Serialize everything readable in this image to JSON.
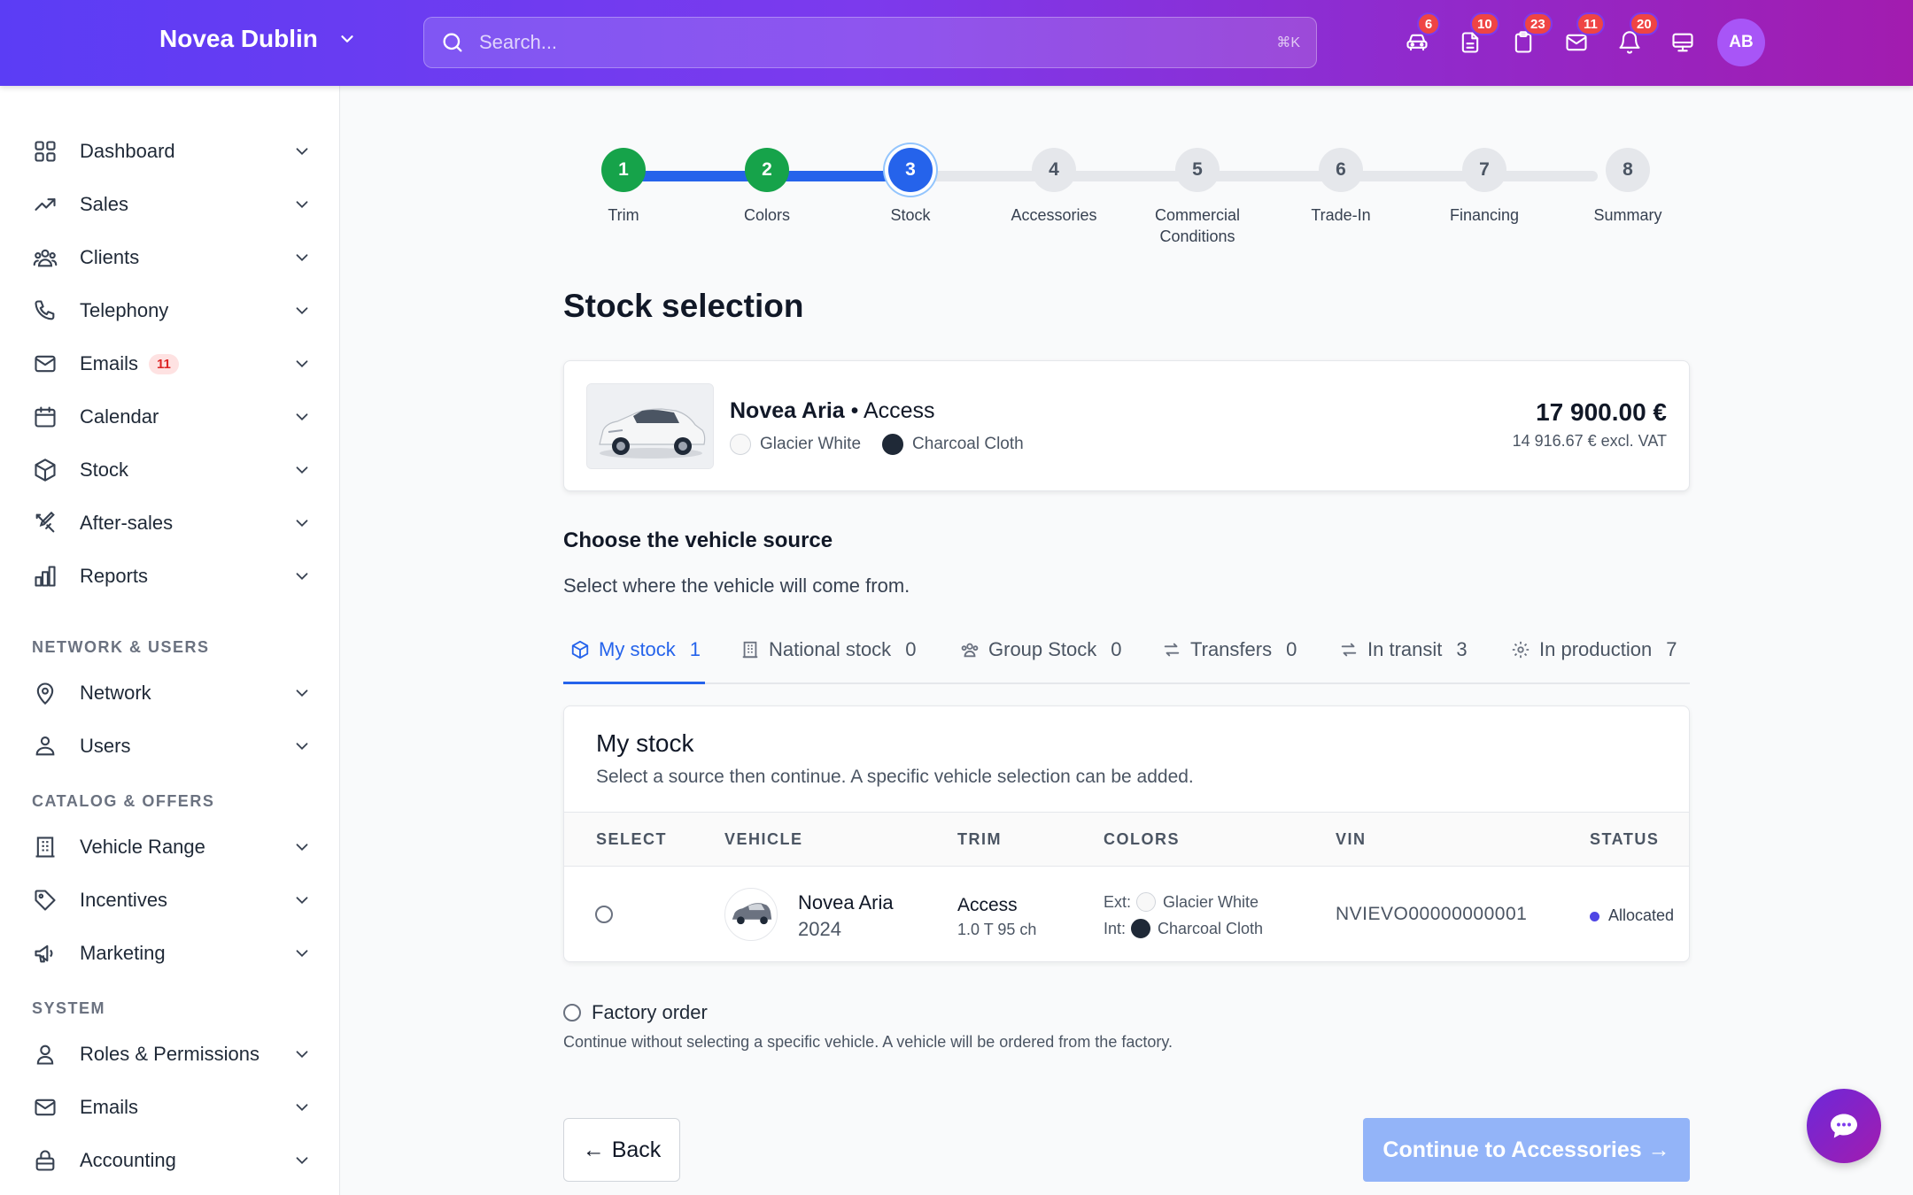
{
  "header": {
    "brand": "Novea Dublin",
    "search_placeholder": "Search...",
    "search_shortcut": "⌘K",
    "icons": [
      {
        "name": "car-icon",
        "badge": "6"
      },
      {
        "name": "document-icon",
        "badge": "10"
      },
      {
        "name": "clipboard-icon",
        "badge": "23"
      },
      {
        "name": "mail-icon",
        "badge": "11"
      },
      {
        "name": "bell-icon",
        "badge": "20"
      },
      {
        "name": "monitor-icon",
        "badge": ""
      }
    ],
    "avatar_initials": "AB"
  },
  "sidebar": {
    "items": [
      {
        "label": "Dashboard",
        "icon": "grid-icon"
      },
      {
        "label": "Sales",
        "icon": "trending-up-icon"
      },
      {
        "label": "Clients",
        "icon": "users-icon"
      },
      {
        "label": "Telephony",
        "icon": "phone-icon"
      },
      {
        "label": "Emails",
        "icon": "mail-icon",
        "badge": "11"
      },
      {
        "label": "Calendar",
        "icon": "calendar-icon"
      },
      {
        "label": "Stock",
        "icon": "box-icon"
      },
      {
        "label": "After-sales",
        "icon": "tools-icon"
      },
      {
        "label": "Reports",
        "icon": "bar-chart-icon"
      }
    ],
    "section_network": "NETWORK & USERS",
    "network_items": [
      {
        "label": "Network",
        "icon": "map-pin-icon"
      },
      {
        "label": "Users",
        "icon": "user-group-icon"
      }
    ],
    "section_catalog": "CATALOG & OFFERS",
    "catalog_items": [
      {
        "label": "Vehicle Range",
        "icon": "building-icon"
      },
      {
        "label": "Incentives",
        "icon": "tag-icon"
      },
      {
        "label": "Marketing",
        "icon": "megaphone-icon"
      }
    ],
    "section_system": "SYSTEM",
    "system_items": [
      {
        "label": "Roles & Permissions",
        "icon": "user-icon"
      },
      {
        "label": "Emails",
        "icon": "mail-icon"
      },
      {
        "label": "Accounting",
        "icon": "lock-icon"
      }
    ]
  },
  "stepper": {
    "current": 3,
    "steps": [
      {
        "num": "1",
        "label": "Trim",
        "state": "done"
      },
      {
        "num": "2",
        "label": "Colors",
        "state": "done"
      },
      {
        "num": "3",
        "label": "Stock",
        "state": "current"
      },
      {
        "num": "4",
        "label": "Accessories",
        "state": "todo"
      },
      {
        "num": "5",
        "label": "Commercial Conditions",
        "state": "todo"
      },
      {
        "num": "6",
        "label": "Trade-In",
        "state": "todo"
      },
      {
        "num": "7",
        "label": "Financing",
        "state": "todo"
      },
      {
        "num": "8",
        "label": "Summary",
        "state": "todo"
      }
    ]
  },
  "page": {
    "title": "Stock selection"
  },
  "vehicle": {
    "model": "Novea Aria",
    "separator": " • ",
    "trim": "Access",
    "exterior": "Glacier White",
    "interior": "Charcoal Cloth",
    "exterior_color": "#f8f8f8",
    "interior_color": "#1f2937",
    "price": "17 900.00 €",
    "price_excl": "14 916.67 € excl. VAT"
  },
  "source": {
    "heading": "Choose the vehicle source",
    "subtitle": "Select where the vehicle will come from.",
    "tabs": [
      {
        "label": "My stock",
        "count": "1",
        "icon": "box-icon"
      },
      {
        "label": "National stock",
        "count": "0",
        "icon": "building-icon"
      },
      {
        "label": "Group Stock",
        "count": "0",
        "icon": "users-icon"
      },
      {
        "label": "Transfers",
        "count": "0",
        "icon": "arrows-icon"
      },
      {
        "label": "In transit",
        "count": "3",
        "icon": "arrows-icon"
      },
      {
        "label": "In production",
        "count": "7",
        "icon": "gear-icon"
      }
    ]
  },
  "stock_table": {
    "title": "My stock",
    "subtitle": "Select a source then continue. A specific vehicle selection can be added.",
    "headers": [
      "SELECT",
      "VEHICLE",
      "TRIM",
      "COLORS",
      "VIN",
      "STATUS"
    ],
    "rows": [
      {
        "model": "Novea Aria",
        "year": "2024",
        "trim": "Access",
        "engine": "1.0 T 95 ch",
        "ext_label": "Ext:",
        "ext_color": "Glacier White",
        "int_label": "Int:",
        "int_color": "Charcoal Cloth",
        "vin": "NVIEVO00000000001",
        "status": "Allocated"
      }
    ]
  },
  "factory": {
    "label": "Factory order",
    "description": "Continue without selecting a specific vehicle. A vehicle will be ordered from the factory."
  },
  "actions": {
    "back": "Back",
    "continue": "Continue to Accessories"
  }
}
